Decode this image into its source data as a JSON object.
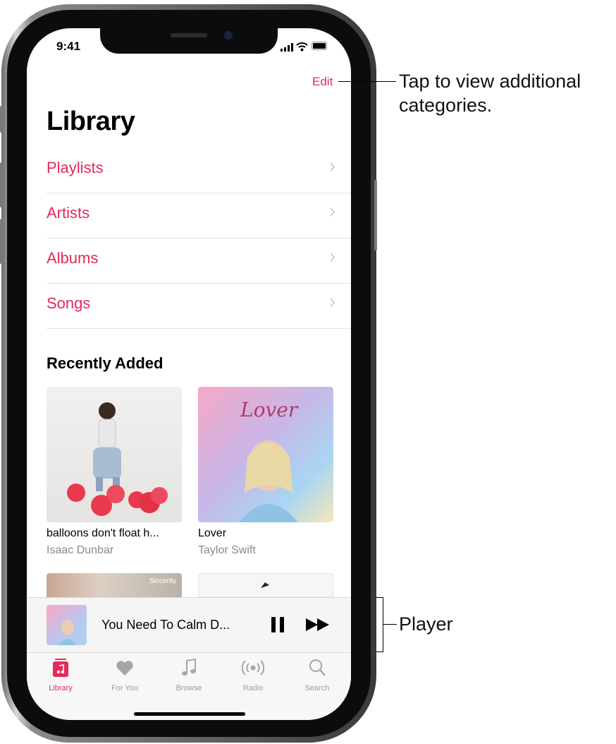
{
  "status_bar": {
    "time": "9:41"
  },
  "nav": {
    "edit_label": "Edit",
    "title": "Library"
  },
  "library_items": [
    {
      "label": "Playlists"
    },
    {
      "label": "Artists"
    },
    {
      "label": "Albums"
    },
    {
      "label": "Songs"
    }
  ],
  "recently_added": {
    "heading": "Recently Added",
    "albums": [
      {
        "title": "balloons don't float h...",
        "artist": "Isaac Dunbar"
      },
      {
        "title": "Lover",
        "artist": "Taylor Swift",
        "cover_script": "Lover"
      }
    ],
    "partial_cover_text": "Sincerity"
  },
  "player": {
    "track": "You Need To Calm D...",
    "pause_icon": "pause-icon",
    "forward_icon": "fast-forward-icon"
  },
  "tabs": [
    {
      "label": "Library",
      "icon": "library-icon",
      "active": true
    },
    {
      "label": "For You",
      "icon": "heart-icon"
    },
    {
      "label": "Browse",
      "icon": "music-note-icon"
    },
    {
      "label": "Radio",
      "icon": "radio-icon"
    },
    {
      "label": "Search",
      "icon": "search-icon"
    }
  ],
  "callouts": {
    "edit": "Tap to view additional categories.",
    "player": "Player"
  },
  "colors": {
    "accent": "#e22b59",
    "secondary_text": "#8a8a8f"
  }
}
